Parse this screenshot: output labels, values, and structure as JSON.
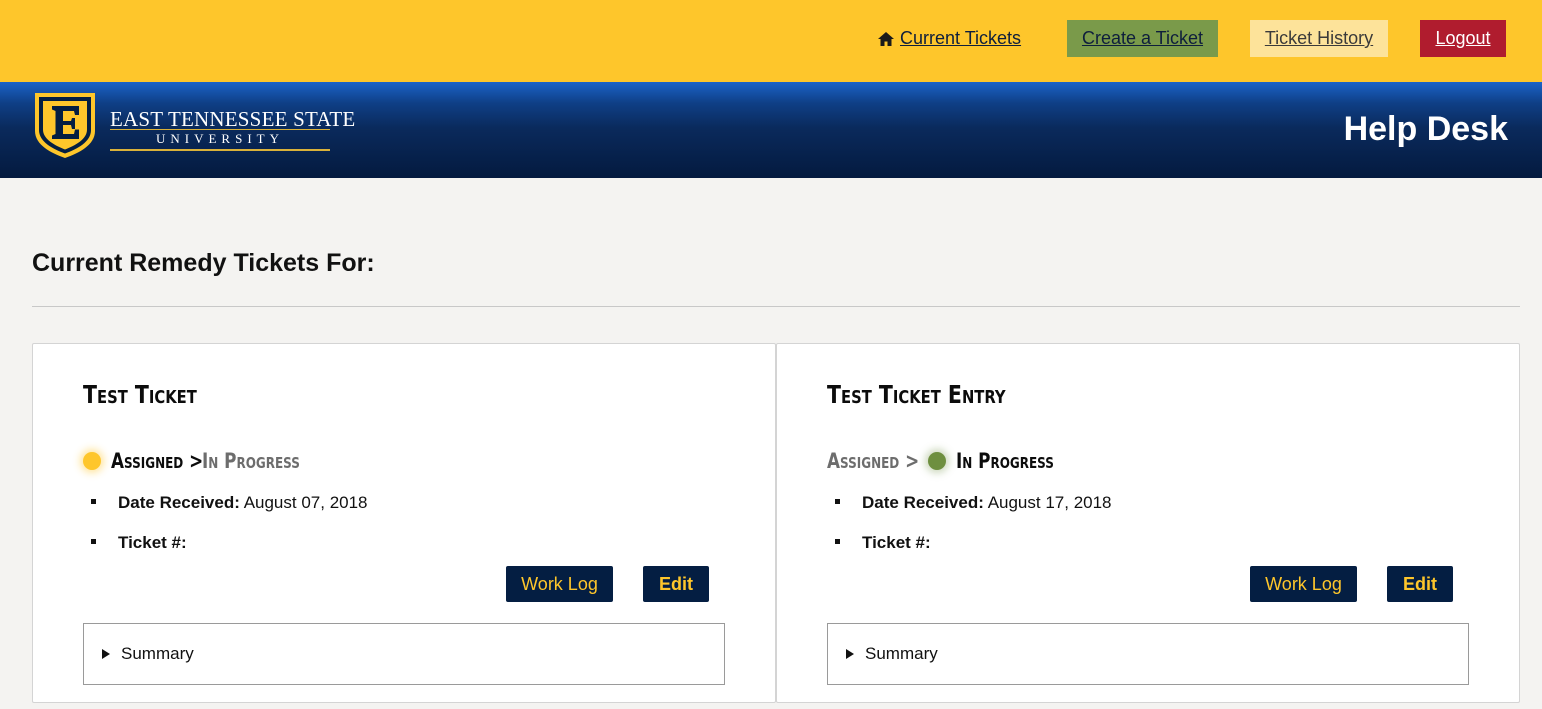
{
  "nav": {
    "current_tickets": "Current Tickets",
    "create_ticket": "Create a Ticket",
    "ticket_history": "Ticket History",
    "logout": "Logout"
  },
  "header": {
    "university_line1": "EAST TENNESSEE STATE",
    "university_line2": "UNIVERSITY",
    "site_title": "Help Desk"
  },
  "page": {
    "heading": "Current Remedy Tickets For:"
  },
  "tickets": [
    {
      "title": "Test Ticket",
      "status_assigned": "Assigned",
      "status_in_progress": "In Progress",
      "current_status": "Assigned",
      "date_label": "Date Received:",
      "date_value": "August 07, 2018",
      "ticket_label": "Ticket #:",
      "ticket_value": "",
      "work_log_label": "Work Log",
      "edit_label": "Edit",
      "summary_label": "Summary"
    },
    {
      "title": "Test Ticket Entry",
      "status_assigned": "Assigned",
      "status_in_progress": "In Progress",
      "current_status": "In Progress",
      "date_label": "Date Received:",
      "date_value": "August 17, 2018",
      "ticket_label": "Ticket #:",
      "ticket_value": "",
      "work_log_label": "Work Log",
      "edit_label": "Edit",
      "summary_label": "Summary"
    }
  ],
  "colors": {
    "topbar": "#fec62b",
    "create_button": "#7a9a4a",
    "history_button": "#fde39a",
    "logout_button": "#b01c2e",
    "navy": "#041e42",
    "gold": "#fec62b",
    "status_assigned_dot": "#fec62b",
    "status_in_progress_dot": "#6e8f3f"
  },
  "icons": {
    "nav_home": "home-icon",
    "logo": "etsu-shield-icon",
    "summary_toggle": "triangle-right-icon",
    "status_chevron": "chevron-right-icon"
  }
}
